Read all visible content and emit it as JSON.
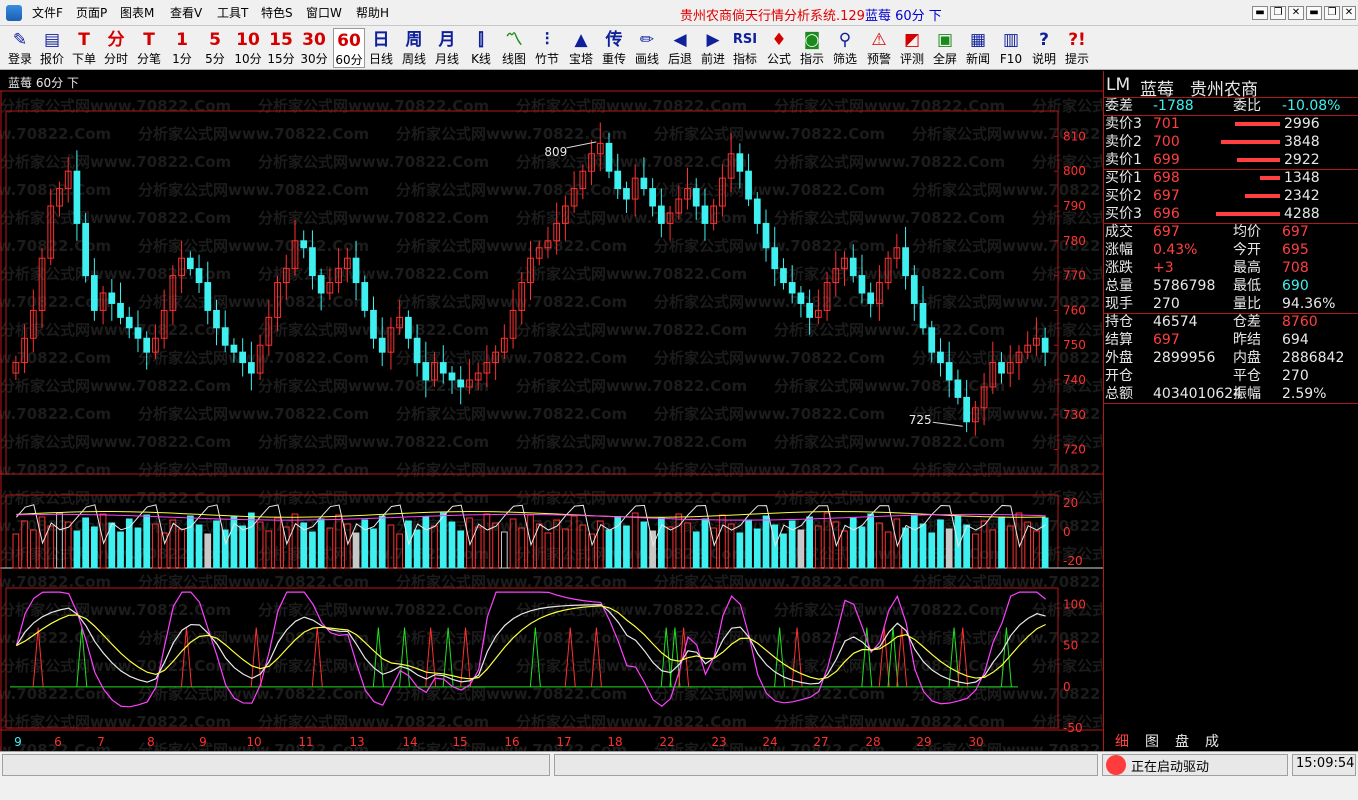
{
  "menubar": {
    "items": [
      "文件F",
      "页面P",
      "图表M",
      "查看V",
      "工具T",
      "特色S",
      "窗口W",
      "帮助H"
    ],
    "title": "贵州农商倘天行情分析系统.129",
    "title_stock": "蓝莓 60分 下",
    "win_buttons": [
      "▬",
      "❐",
      "✕",
      "▬",
      "❐",
      "✕"
    ]
  },
  "toolbar": {
    "items": [
      {
        "label": "登录",
        "glyph": "✎",
        "color": "navy"
      },
      {
        "label": "报价",
        "glyph": "▤",
        "color": "navy"
      },
      {
        "label": "下单",
        "glyph": "T",
        "color": "red"
      },
      {
        "label": "分时",
        "glyph": "分",
        "color": "red"
      },
      {
        "label": "分笔",
        "glyph": "T",
        "color": "red"
      },
      {
        "label": "1分",
        "glyph": "1",
        "color": "red"
      },
      {
        "label": "5分",
        "glyph": "5",
        "color": "red"
      },
      {
        "label": "10分",
        "glyph": "10",
        "color": "red"
      },
      {
        "label": "15分",
        "glyph": "15",
        "color": "red"
      },
      {
        "label": "30分",
        "glyph": "30",
        "color": "red"
      },
      {
        "label": "60分",
        "glyph": "60",
        "color": "red"
      },
      {
        "label": "日线",
        "glyph": "日",
        "color": "navy"
      },
      {
        "label": "周线",
        "glyph": "周",
        "color": "navy"
      },
      {
        "label": "月线",
        "glyph": "月",
        "color": "navy"
      },
      {
        "label": "K线",
        "glyph": "⫿",
        "color": "navy"
      },
      {
        "label": "线图",
        "glyph": "〽",
        "color": "grn"
      },
      {
        "label": "竹节",
        "glyph": "⫶",
        "color": "navy"
      },
      {
        "label": "宝塔",
        "glyph": "▲",
        "color": "navy"
      },
      {
        "label": "重传",
        "glyph": "传",
        "color": "navy"
      },
      {
        "label": "画线",
        "glyph": "✏",
        "color": "navy"
      },
      {
        "label": "后退",
        "glyph": "◀",
        "color": "navy"
      },
      {
        "label": "前进",
        "glyph": "▶",
        "color": "navy"
      },
      {
        "label": "指标",
        "glyph": "RSI",
        "color": "navy"
      },
      {
        "label": "公式",
        "glyph": "♦",
        "color": "red"
      },
      {
        "label": "指示",
        "glyph": "◙",
        "color": "grn"
      },
      {
        "label": "筛选",
        "glyph": "⚲",
        "color": "navy"
      },
      {
        "label": "预警",
        "glyph": "⚠",
        "color": "red"
      },
      {
        "label": "评测",
        "glyph": "◩",
        "color": "red"
      },
      {
        "label": "全屏",
        "glyph": "▣",
        "color": "grn"
      },
      {
        "label": "新闻",
        "glyph": "▦",
        "color": "navy"
      },
      {
        "label": "F10",
        "glyph": "▥",
        "color": "navy"
      },
      {
        "label": "说明",
        "glyph": "?",
        "color": "navy"
      },
      {
        "label": "提示",
        "glyph": "?!",
        "color": "red"
      }
    ],
    "selected_index": 10
  },
  "chart": {
    "panel_title": "蓝莓 60分 下",
    "price_ticks": [
      "810",
      "800",
      "790",
      "780",
      "770",
      "760",
      "750",
      "740",
      "730",
      "720"
    ],
    "vol_ticks": [
      "20",
      "0",
      "-20"
    ],
    "osc_ticks": [
      "100",
      "50",
      "0",
      "-50"
    ],
    "x_labels": [
      "9",
      "6",
      "7",
      "8",
      "9",
      "10",
      "11",
      "13",
      "14",
      "15",
      "16",
      "17",
      "18",
      "22",
      "23",
      "24",
      "27",
      "28",
      "29",
      "30"
    ],
    "high_label": "809",
    "low_label": "725",
    "watermark": "分析家公式网www.70822.Com"
  },
  "chart_data": {
    "type": "candlestick",
    "price_ylim": [
      715,
      815
    ],
    "high": 809,
    "low": 725,
    "closes": [
      745,
      752,
      760,
      775,
      790,
      795,
      800,
      785,
      770,
      760,
      765,
      762,
      758,
      755,
      752,
      748,
      752,
      760,
      770,
      775,
      772,
      768,
      760,
      755,
      750,
      748,
      745,
      742,
      750,
      758,
      768,
      772,
      780,
      778,
      770,
      765,
      768,
      772,
      775,
      768,
      760,
      752,
      748,
      755,
      758,
      752,
      745,
      740,
      745,
      742,
      740,
      738,
      740,
      742,
      745,
      748,
      752,
      760,
      768,
      775,
      778,
      780,
      785,
      790,
      795,
      800,
      805,
      808,
      800,
      795,
      792,
      798,
      795,
      790,
      785,
      788,
      792,
      795,
      790,
      785,
      790,
      798,
      805,
      800,
      792,
      785,
      778,
      772,
      768,
      765,
      762,
      758,
      760,
      768,
      772,
      775,
      770,
      765,
      762,
      768,
      775,
      778,
      770,
      762,
      755,
      748,
      745,
      740,
      735,
      728,
      732,
      738,
      745,
      742,
      745,
      748,
      750,
      752,
      748
    ],
    "oscillator": {
      "ylim": [
        -50,
        120
      ]
    }
  },
  "quote": {
    "header": [
      "LM",
      "蓝莓",
      "贵州农商"
    ],
    "weicha": {
      "k": "委差",
      "v": "-1788",
      "k2": "委比",
      "v2": "-10.08%"
    },
    "asks": [
      {
        "k": "卖价3",
        "v": "701",
        "vol": "2996",
        "bar": 32
      },
      {
        "k": "卖价2",
        "v": "700",
        "vol": "3848",
        "bar": 42
      },
      {
        "k": "卖价1",
        "v": "699",
        "vol": "2922",
        "bar": 31
      }
    ],
    "bids": [
      {
        "k": "买价1",
        "v": "698",
        "vol": "1348",
        "bar": 14
      },
      {
        "k": "买价2",
        "v": "697",
        "vol": "2342",
        "bar": 25
      },
      {
        "k": "买价3",
        "v": "696",
        "vol": "4288",
        "bar": 46
      }
    ],
    "stats1": [
      {
        "k": "成交",
        "v": "697",
        "vc": "red",
        "k2": "均价",
        "v2": "697",
        "v2c": "red"
      },
      {
        "k": "涨幅",
        "v": "0.43%",
        "vc": "red",
        "k2": "今开",
        "v2": "695",
        "v2c": "red"
      },
      {
        "k": "涨跌",
        "v": "+3",
        "vc": "red",
        "k2": "最高",
        "v2": "708",
        "v2c": "red"
      },
      {
        "k": "总量",
        "v": "5786798",
        "vc": "white",
        "k2": "最低",
        "v2": "690",
        "v2c": "cyan"
      },
      {
        "k": "现手",
        "v": "270",
        "vc": "white",
        "k2": "量比",
        "v2": "94.36%",
        "v2c": "white"
      }
    ],
    "stats2": [
      {
        "k": "持仓",
        "v": "46574",
        "vc": "white",
        "k2": "仓差",
        "v2": "8760",
        "v2c": "red"
      },
      {
        "k": "结算",
        "v": "697",
        "vc": "red",
        "k2": "昨结",
        "v2": "694",
        "v2c": "white"
      },
      {
        "k": "外盘",
        "v": "2899956",
        "vc": "white",
        "k2": "内盘",
        "v2": "2886842",
        "v2c": "white"
      },
      {
        "k": "开仓",
        "v": "",
        "vc": "white",
        "k2": "平仓",
        "v2": "270",
        "v2c": "white"
      },
      {
        "k": "总额",
        "v": "4034010624",
        "vc": "white",
        "k2": "振幅",
        "v2": "2.59%",
        "v2c": "white"
      }
    ],
    "tabs": [
      "细",
      "图",
      "盘",
      "成"
    ]
  },
  "statusbar": {
    "status": "正在启动驱动",
    "time": "15:09:54"
  }
}
